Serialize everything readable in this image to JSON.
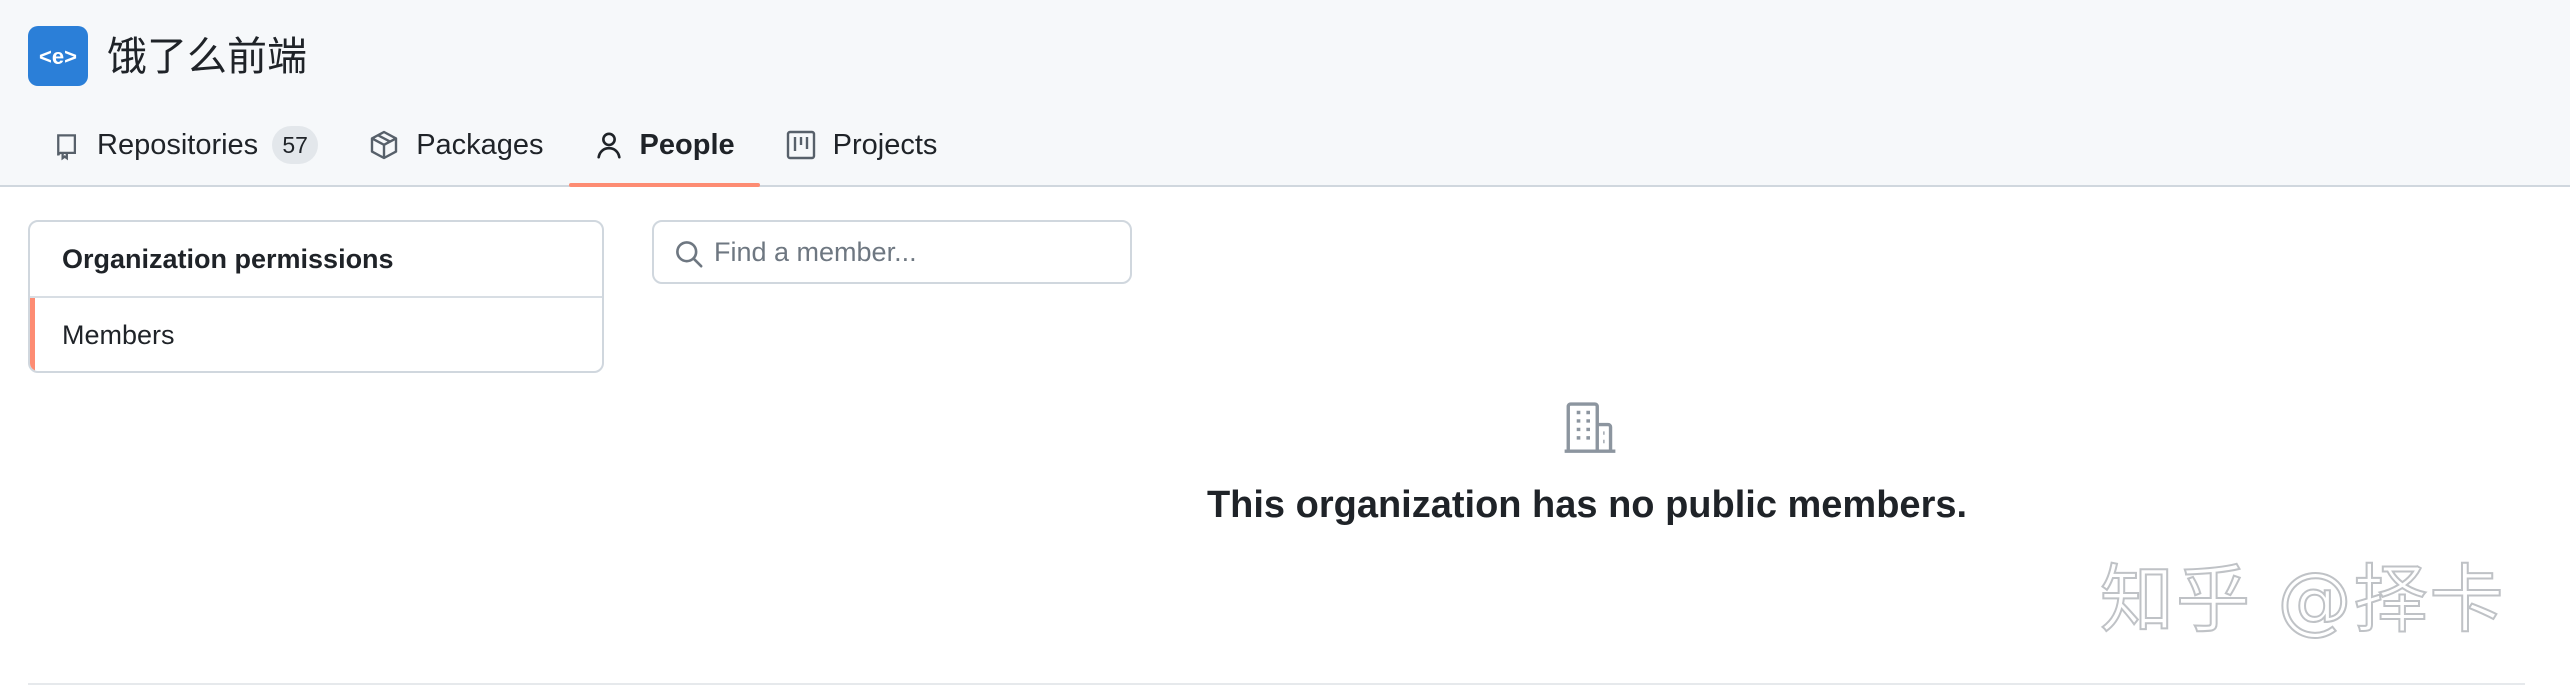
{
  "org": {
    "logo_text": "<e>",
    "name": "饿了么前端"
  },
  "tabs": [
    {
      "label": "Repositories",
      "icon": "repo-icon",
      "counter": "57",
      "selected": false
    },
    {
      "label": "Packages",
      "icon": "package-icon",
      "selected": false
    },
    {
      "label": "People",
      "icon": "person-icon",
      "selected": true
    },
    {
      "label": "Projects",
      "icon": "project-icon",
      "selected": false
    }
  ],
  "sidebar": {
    "header": "Organization permissions",
    "items": [
      {
        "label": "Members",
        "selected": true
      }
    ]
  },
  "search": {
    "placeholder": "Find a member...",
    "value": "",
    "icon": "search-icon"
  },
  "blankslate": {
    "icon": "organization-icon",
    "title": "This organization has no public members."
  },
  "watermark": "知乎 @择卡",
  "colors": {
    "accent_underline": "#fd8c73",
    "logo_bg": "#2b7fd8",
    "header_bg": "#f6f8fa"
  }
}
